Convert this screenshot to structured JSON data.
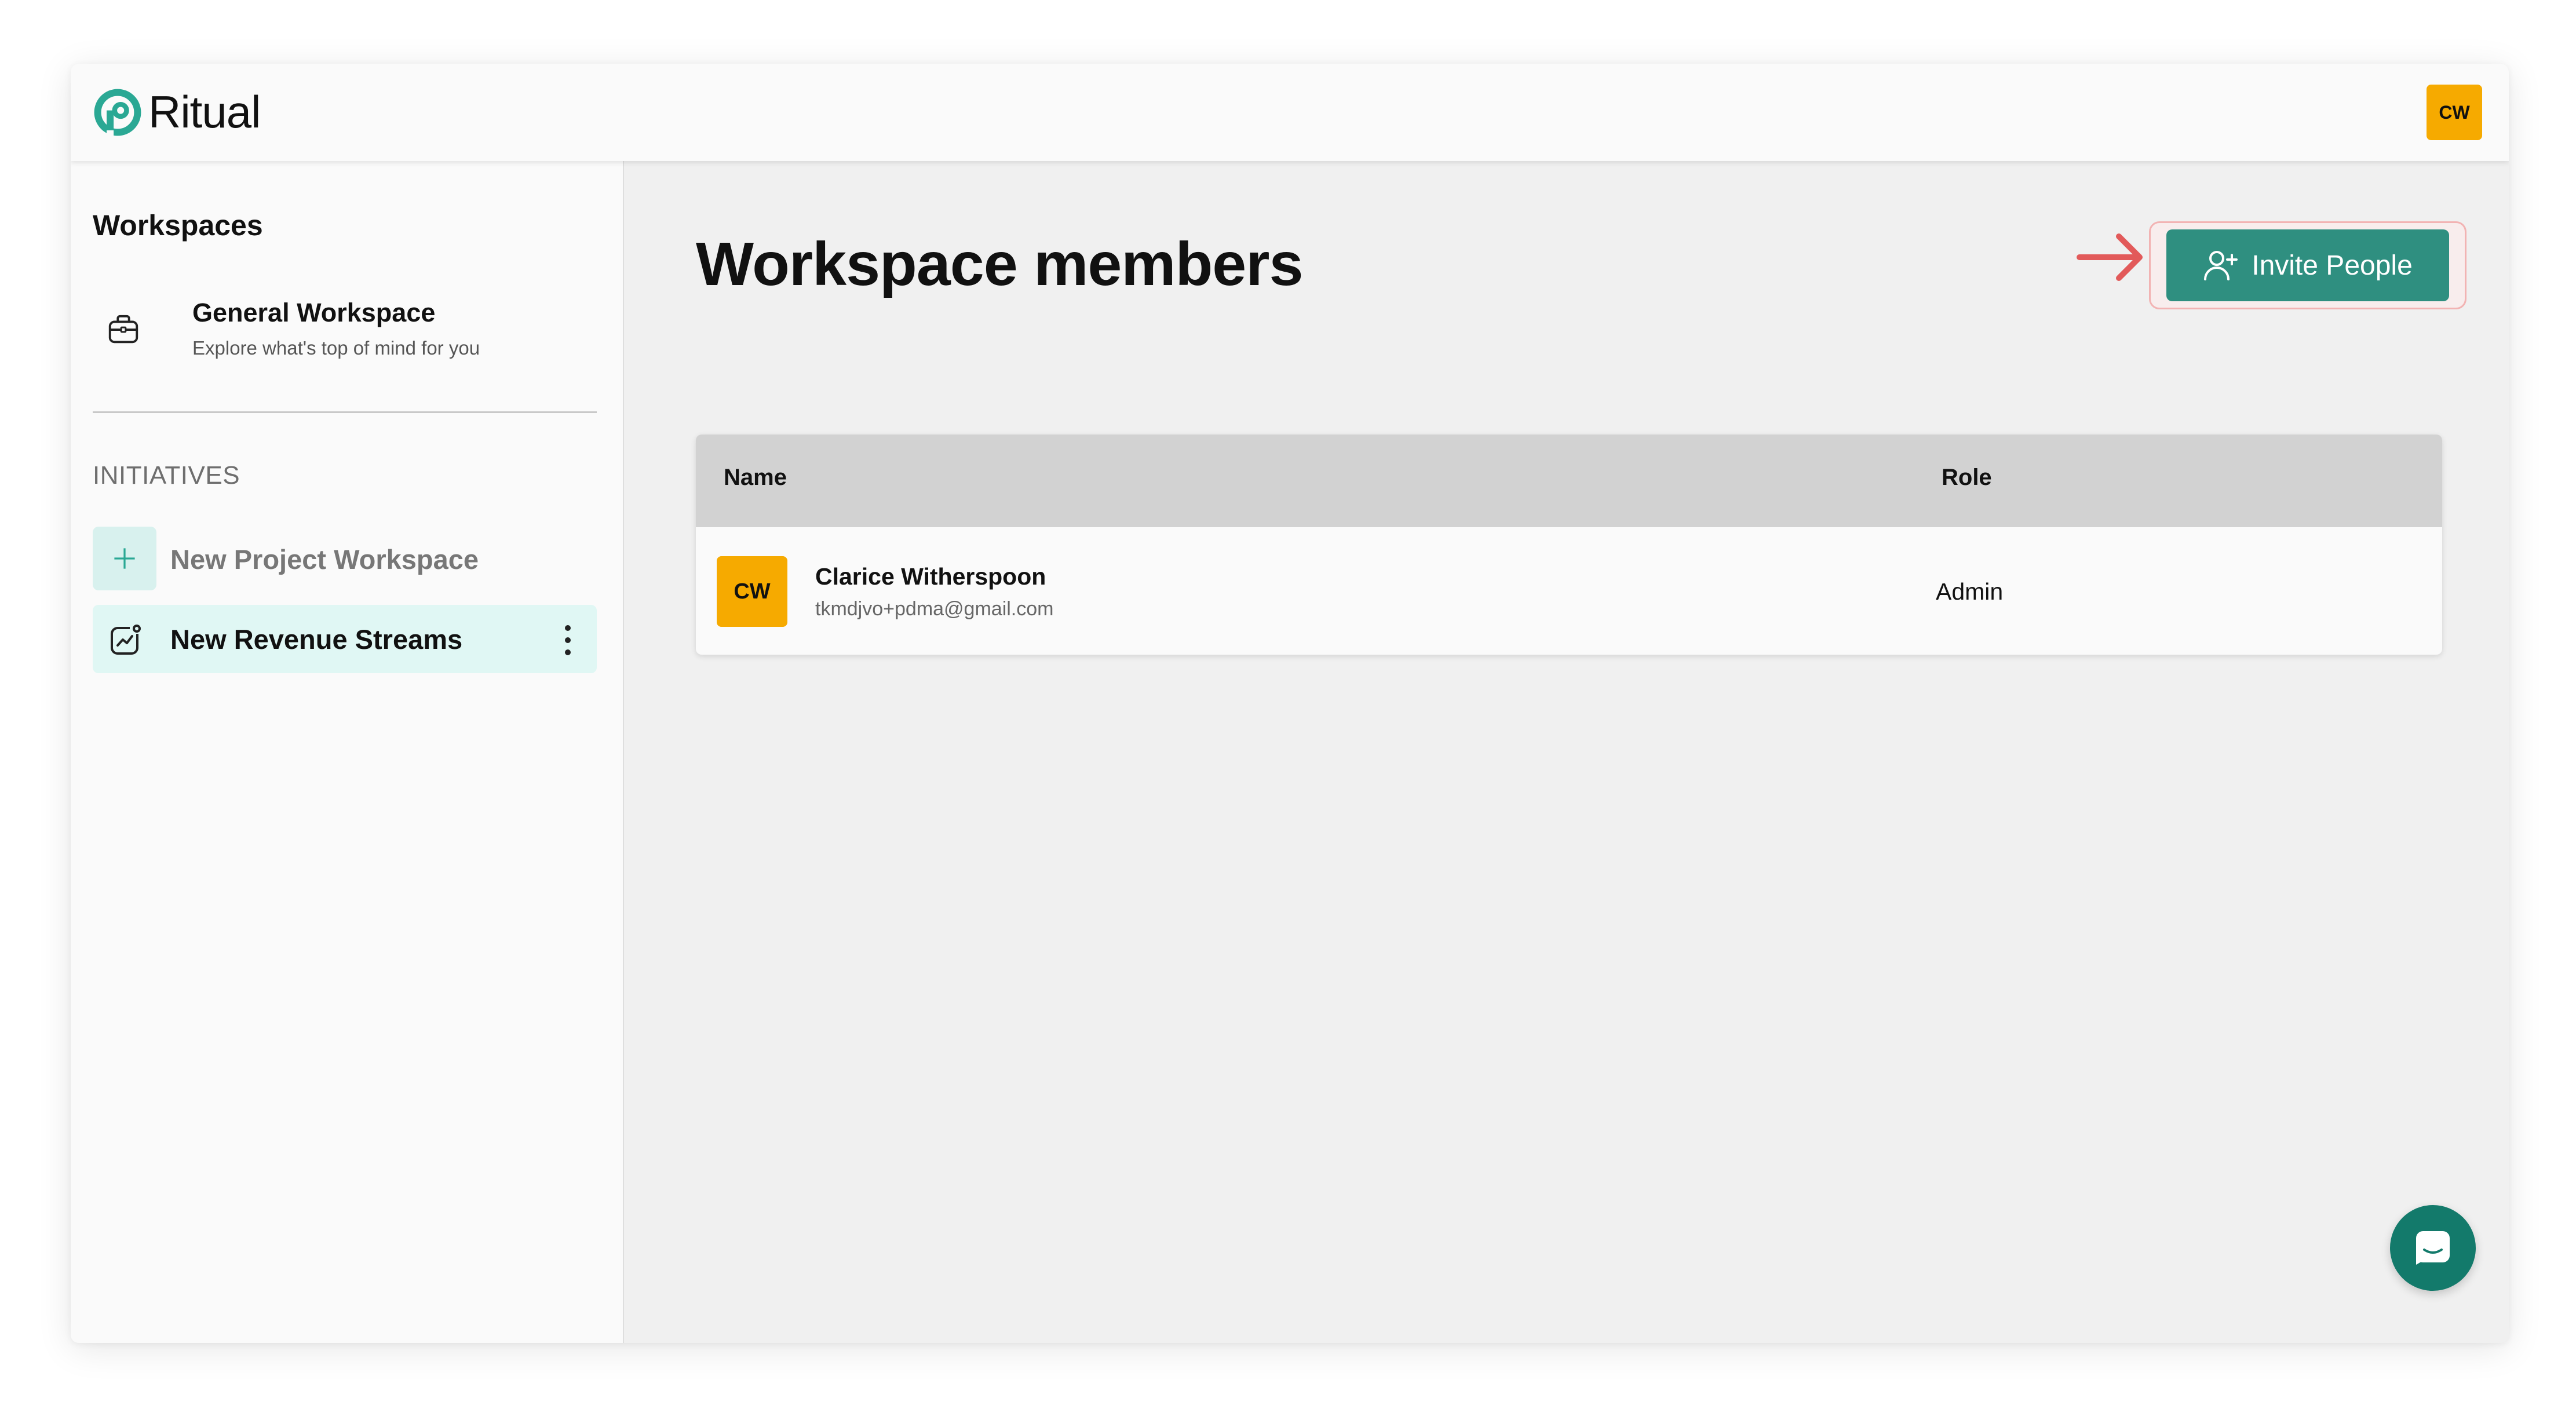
{
  "header": {
    "logo_text": "Ritual",
    "user_initials": "CW"
  },
  "sidebar": {
    "title": "Workspaces",
    "general_workspace": {
      "name": "General Workspace",
      "subtitle": "Explore what's top of mind for you"
    },
    "section_label": "INITIATIVES",
    "items": [
      {
        "label": "New Project Workspace",
        "icon": "plus-icon"
      },
      {
        "label": "New Revenue Streams",
        "icon": "chart-icon",
        "active": true
      }
    ]
  },
  "main": {
    "title": "Workspace members",
    "invite_button_label": "Invite People",
    "table": {
      "columns": [
        "Name",
        "Role"
      ],
      "rows": [
        {
          "initials": "CW",
          "name": "Clarice Witherspoon",
          "email": "tkmdjvo+pdma@gmail.com",
          "role": "Admin"
        }
      ]
    }
  },
  "colors": {
    "brand": "#2f8f80",
    "avatar": "#f6aa00",
    "active_item": "#e0f7f4",
    "annotation": "#e25a5a"
  }
}
